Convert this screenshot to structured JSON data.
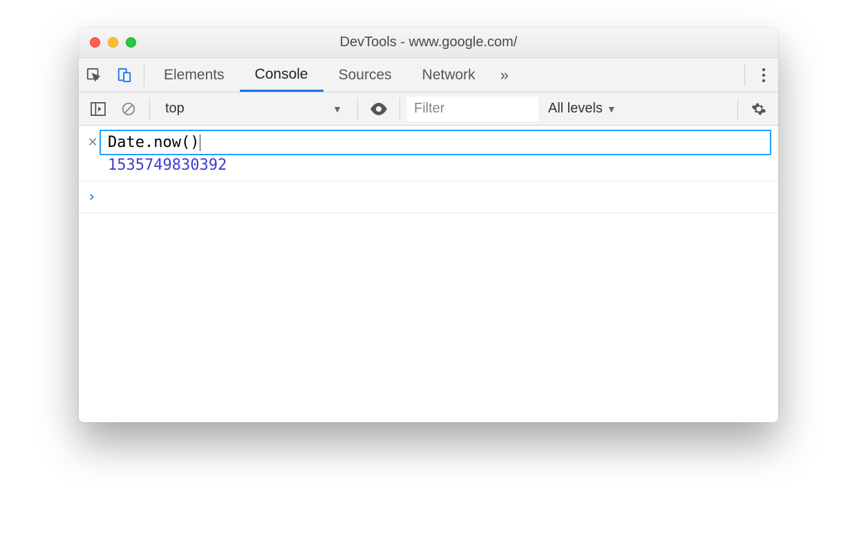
{
  "window": {
    "title": "DevTools - www.google.com/"
  },
  "tabs": {
    "items": [
      "Elements",
      "Console",
      "Sources",
      "Network"
    ],
    "active_index": 1
  },
  "console_toolbar": {
    "context": "top",
    "filter_placeholder": "Filter",
    "levels_label": "All levels"
  },
  "console": {
    "live_expression": "Date.now()",
    "live_result": "1535749830392",
    "prompt_symbol": "›"
  },
  "colors": {
    "tab_active_underline": "#1a73e8",
    "live_border": "#1aa0ff",
    "result_text": "#3b3ecf"
  }
}
